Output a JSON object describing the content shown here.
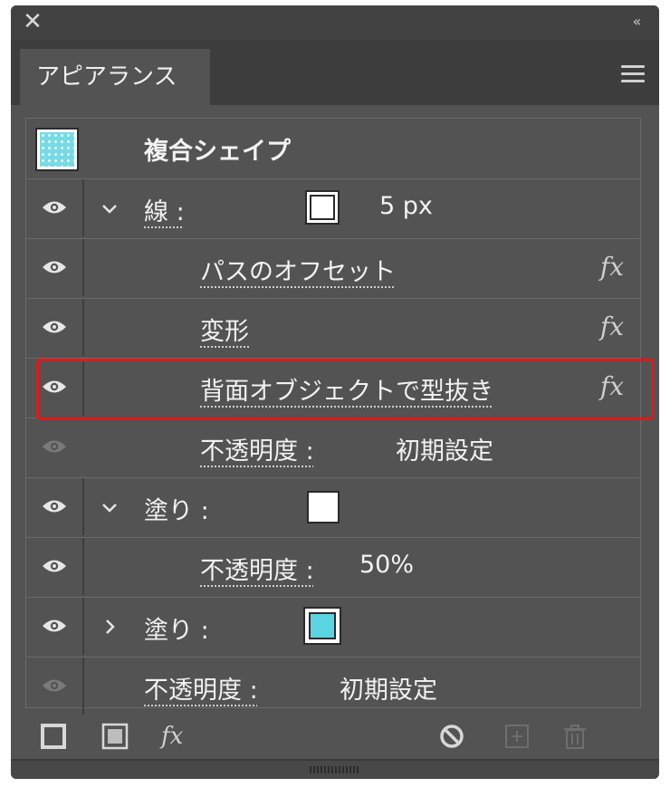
{
  "window": {
    "close_glyph": "✕",
    "collapse_glyph": "‹‹"
  },
  "tab": {
    "title": "アピアランス"
  },
  "header_row": {
    "title": "複合シェイプ"
  },
  "rows": [
    {
      "label": "線 :",
      "value": "5 px",
      "expanded": true,
      "swatch": "white"
    },
    {
      "label": "パスのオフセット",
      "fx": "fx"
    },
    {
      "label": "変形",
      "fx": "fx"
    },
    {
      "label": "背面オブジェクトで型抜き",
      "fx": "fx",
      "highlighted": true
    },
    {
      "label": "不透明度 :",
      "value": "初期設定",
      "eye_dim": true
    },
    {
      "label": "塗り :",
      "expanded": true,
      "swatch": "white"
    },
    {
      "label": "不透明度 :",
      "value": "50%"
    },
    {
      "label": "塗り :",
      "expanded": false,
      "swatch": "cyan"
    },
    {
      "label": "不透明度 :",
      "value": "初期設定",
      "eye_dim": true
    }
  ],
  "chevrons": {
    "down": "⌄",
    "right": "›"
  },
  "toolbar": {
    "fx_label": "fx"
  },
  "colors": {
    "panel_bg": "#535353",
    "highlight": "#e01818",
    "cyan_fill": "#5bd4e2"
  }
}
